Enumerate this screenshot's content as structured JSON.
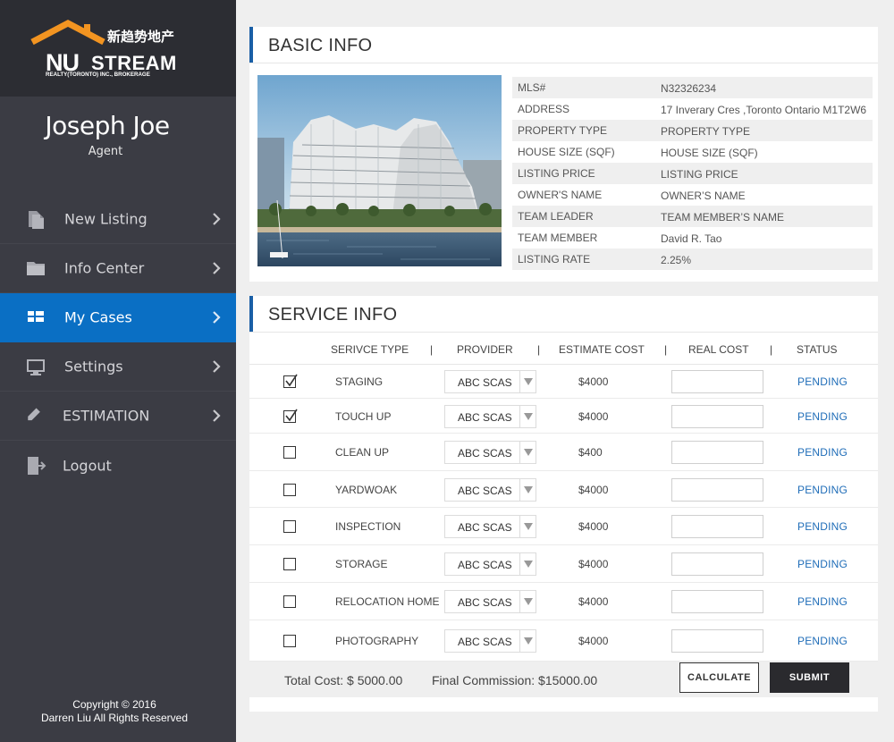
{
  "brand": {
    "logo_text": "NU STREAM",
    "logo_chinese": "新趋势地产",
    "logo_subtitle": "REALTY(TORONTO) INC., BROKERAGE",
    "roof_color": "#f29421"
  },
  "profile": {
    "name": "Joseph Joe",
    "role": "Agent"
  },
  "nav": {
    "items": [
      {
        "label": "New Listing",
        "icon": "document-copy-icon"
      },
      {
        "label": "Info Center",
        "icon": "folder-icon"
      },
      {
        "label": "My Cases",
        "icon": "grid-icon",
        "active": true
      },
      {
        "label": "Settings",
        "icon": "monitor-icon"
      },
      {
        "label": "ESTIMATION",
        "icon": "pencil-icon"
      },
      {
        "label": "Logout",
        "icon": "logout-icon"
      }
    ],
    "active_color": "#0a6fc4"
  },
  "footer": {
    "line1": "Copyright © 2016",
    "line2": "Darren Liu All Rights Reserved"
  },
  "basic_info": {
    "title": "BASIC INFO",
    "rows": [
      {
        "label": "MLS#",
        "value": "N32326234"
      },
      {
        "label": "ADDRESS",
        "value": "17 Inverary Cres ,Toronto Ontario M1T2W6"
      },
      {
        "label": "PROPERTY TYPE",
        "value": "PROPERTY TYPE"
      },
      {
        "label": "HOUSE SIZE (SQF)",
        "value": "HOUSE SIZE (SQF)"
      },
      {
        "label": "LISTING PRICE",
        "value": "LISTING PRICE"
      },
      {
        "label": "OWNER'S NAME",
        "value": "OWNER’S NAME"
      },
      {
        "label": "TEAM LEADER",
        "value": "TEAM MEMBER’S NAME"
      },
      {
        "label": "TEAM MEMBER",
        "value": "David R. Tao"
      },
      {
        "label": "LISTING RATE",
        "value": "2.25%"
      }
    ]
  },
  "service_info": {
    "title": "SERVICE INFO",
    "headers": {
      "type": "SERIVCE TYPE",
      "provider": "PROVIDER",
      "estimate": "ESTIMATE COST",
      "real": "REAL  COST",
      "status": "STATUS",
      "separator": "|"
    },
    "rows": [
      {
        "type": "STAGING",
        "provider": "ABC SCAS",
        "estimate": "$4000",
        "real": "",
        "status": "PENDING",
        "checked": true
      },
      {
        "type": "TOUCH UP",
        "provider": "ABC SCAS",
        "estimate": "$4000",
        "real": "",
        "status": "PENDING",
        "checked": true
      },
      {
        "type": "CLEAN UP",
        "provider": "ABC SCAS",
        "estimate": "$400",
        "real": "",
        "status": "PENDING",
        "checked": false
      },
      {
        "type": "YARDWOAK",
        "provider": "ABC SCAS",
        "estimate": "$4000",
        "real": "",
        "status": "PENDING",
        "checked": false
      },
      {
        "type": "INSPECTION",
        "provider": "ABC SCAS",
        "estimate": "$4000",
        "real": "",
        "status": "PENDING",
        "checked": false
      },
      {
        "type": "STORAGE",
        "provider": "ABC SCAS",
        "estimate": "$4000",
        "real": "",
        "status": "PENDING",
        "checked": false
      },
      {
        "type": "RELOCATION HOME",
        "provider": "ABC SCAS",
        "estimate": "$4000",
        "real": "",
        "status": "PENDING",
        "checked": false
      },
      {
        "type": "PHOTOGRAPHY",
        "provider": "ABC SCAS",
        "estimate": "$4000",
        "real": "",
        "status": "PENDING",
        "checked": false
      }
    ],
    "total_cost": "Total Cost: $ 5000.00",
    "final_commission": "Final Commission: $15000.00",
    "calculate_label": "CALCULATE",
    "submit_label": "SUBMIT",
    "status_color": "#1f6db8"
  }
}
